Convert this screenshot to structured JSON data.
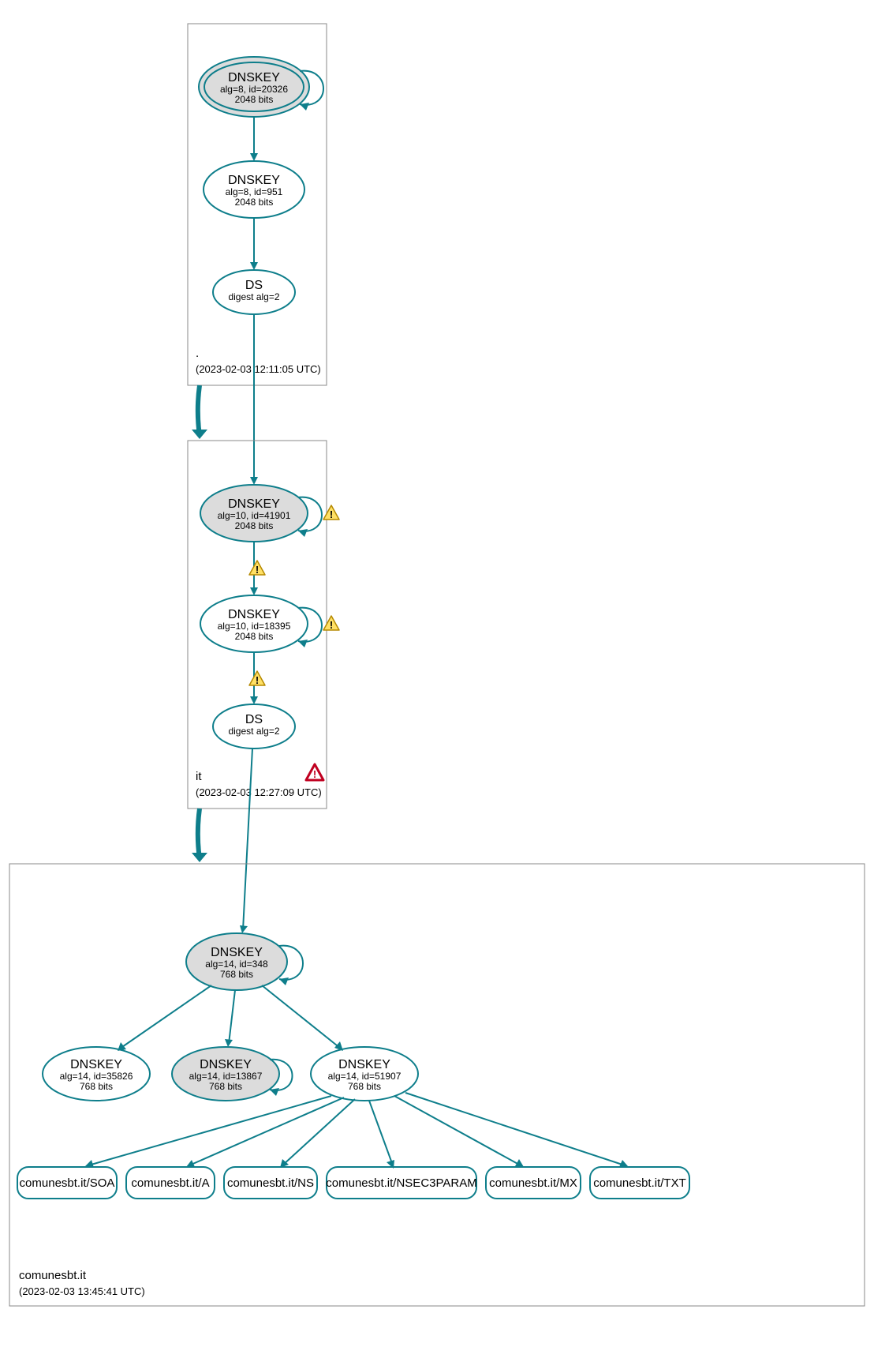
{
  "zones": {
    "root": {
      "label": ".",
      "timestamp": "(2023-02-03 12:11:05 UTC)",
      "nodes": {
        "ksk": {
          "title": "DNSKEY",
          "line2": "alg=8, id=20326",
          "line3": "2048 bits"
        },
        "zsk": {
          "title": "DNSKEY",
          "line2": "alg=8, id=951",
          "line3": "2048 bits"
        },
        "ds": {
          "title": "DS",
          "line2": "digest alg=2"
        }
      }
    },
    "it": {
      "label": "it",
      "timestamp": "(2023-02-03 12:27:09 UTC)",
      "nodes": {
        "ksk": {
          "title": "DNSKEY",
          "line2": "alg=10, id=41901",
          "line3": "2048 bits"
        },
        "zsk": {
          "title": "DNSKEY",
          "line2": "alg=10, id=18395",
          "line3": "2048 bits"
        },
        "ds": {
          "title": "DS",
          "line2": "digest alg=2"
        }
      }
    },
    "leaf": {
      "label": "comunesbt.it",
      "timestamp": "(2023-02-03 13:45:41 UTC)",
      "nodes": {
        "ksk": {
          "title": "DNSKEY",
          "line2": "alg=14, id=348",
          "line3": "768 bits"
        },
        "k1": {
          "title": "DNSKEY",
          "line2": "alg=14, id=35826",
          "line3": "768 bits"
        },
        "k2": {
          "title": "DNSKEY",
          "line2": "alg=14, id=13867",
          "line3": "768 bits"
        },
        "k3": {
          "title": "DNSKEY",
          "line2": "alg=14, id=51907",
          "line3": "768 bits"
        }
      },
      "records": {
        "r1": "comunesbt.it/SOA",
        "r2": "comunesbt.it/A",
        "r3": "comunesbt.it/NS",
        "r4": "comunesbt.it/NSEC3PARAM",
        "r5": "comunesbt.it/MX",
        "r6": "comunesbt.it/TXT"
      }
    }
  }
}
